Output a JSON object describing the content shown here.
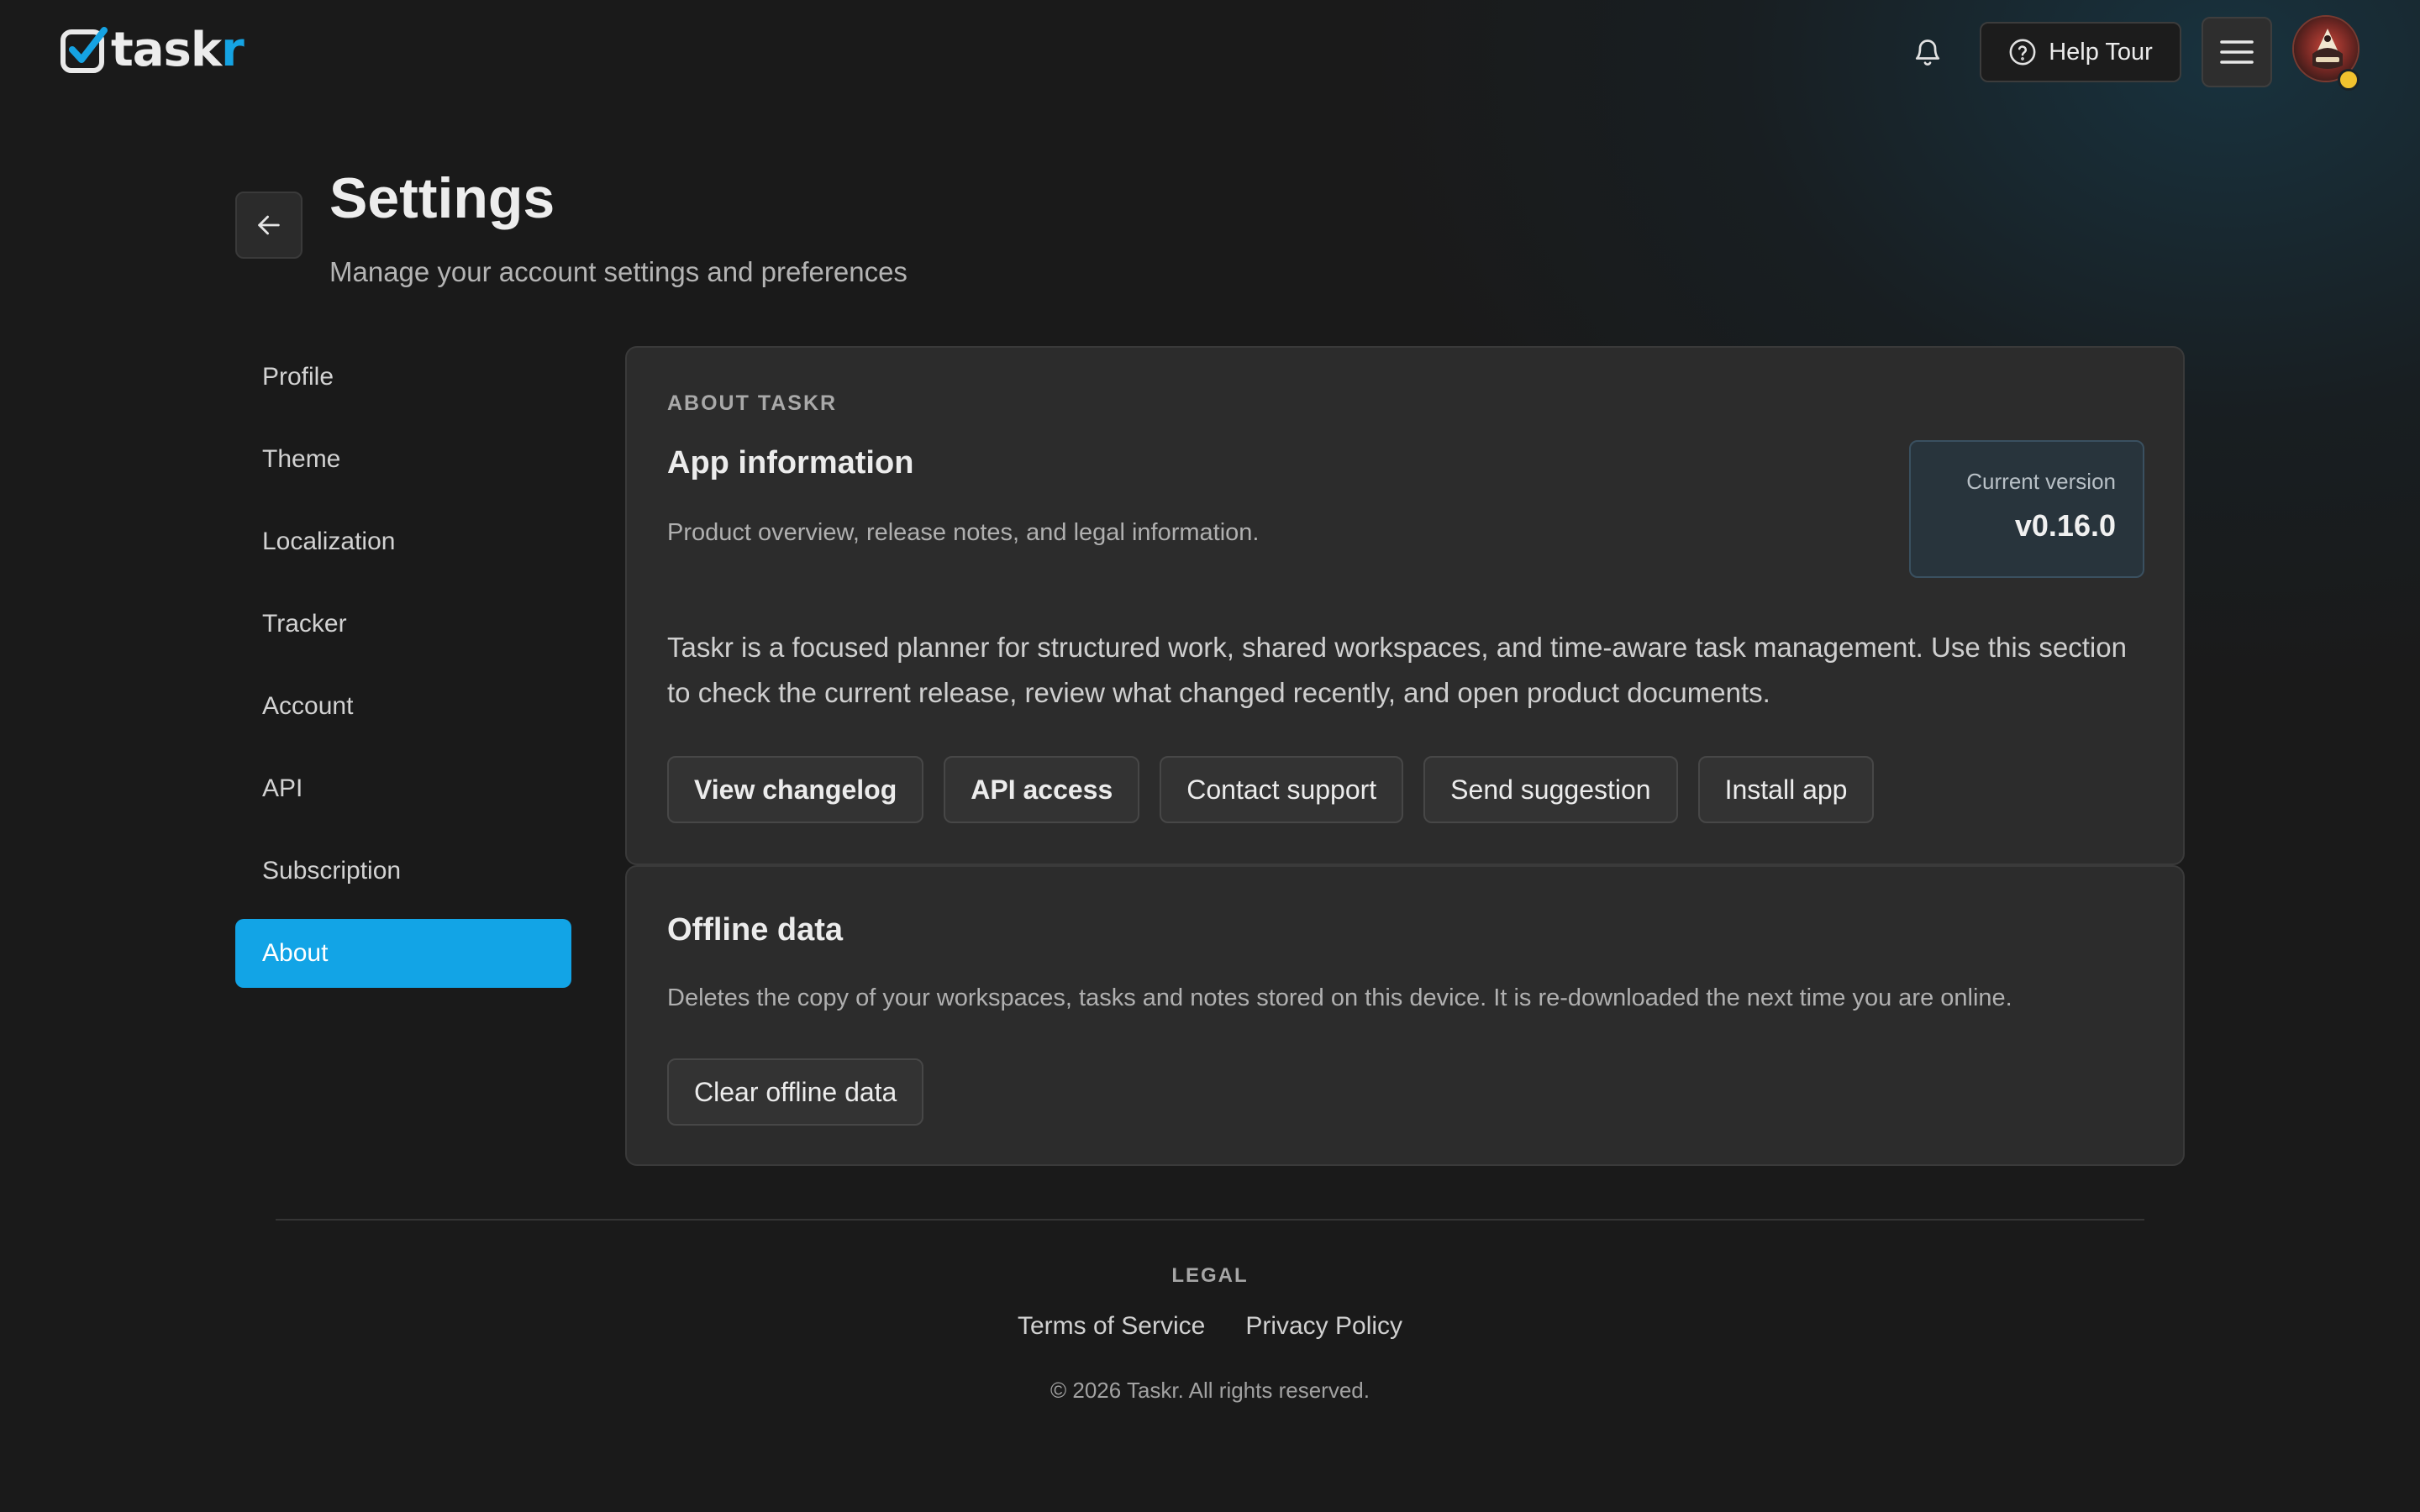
{
  "header": {
    "logo": {
      "text_base": "task",
      "text_accent": "r"
    },
    "bell_icon": "bell-icon",
    "help_tour_label": "Help Tour",
    "menu_icon": "hamburger-menu-icon",
    "avatar_icon": "user-avatar"
  },
  "page": {
    "title": "Settings",
    "subtitle": "Manage your account settings and preferences"
  },
  "sidebar": {
    "items": [
      {
        "label": "Profile",
        "active": false
      },
      {
        "label": "Theme",
        "active": false
      },
      {
        "label": "Localization",
        "active": false
      },
      {
        "label": "Tracker",
        "active": false
      },
      {
        "label": "Account",
        "active": false
      },
      {
        "label": "API",
        "active": false
      },
      {
        "label": "Subscription",
        "active": false
      },
      {
        "label": "About",
        "active": true
      }
    ]
  },
  "about_card": {
    "eyebrow": "ABOUT TASKR",
    "title": "App information",
    "description": "Product overview, release notes, and legal information.",
    "version_label": "Current version",
    "version_value": "v0.16.0",
    "body": "Taskr is a focused planner for structured work, shared workspaces, and time-aware task management. Use this section to check the current release, review what changed recently, and open product documents.",
    "buttons": [
      {
        "label": "View changelog"
      },
      {
        "label": "API access"
      },
      {
        "label": "Contact support"
      },
      {
        "label": "Send suggestion"
      },
      {
        "label": "Install app"
      }
    ]
  },
  "offline_card": {
    "title": "Offline data",
    "description": "Deletes the copy of your workspaces, tasks and notes stored on this device. It is re-downloaded the next time you are online.",
    "button_label": "Clear offline data"
  },
  "footer": {
    "legal_label": "LEGAL",
    "links": [
      {
        "label": "Terms of Service"
      },
      {
        "label": "Privacy Policy"
      }
    ],
    "copyright": "© 2026 Taskr. All rights reserved."
  },
  "colors": {
    "accent": "#12a4e6",
    "background": "#1a1a1a",
    "card": "#2c2c2c"
  }
}
